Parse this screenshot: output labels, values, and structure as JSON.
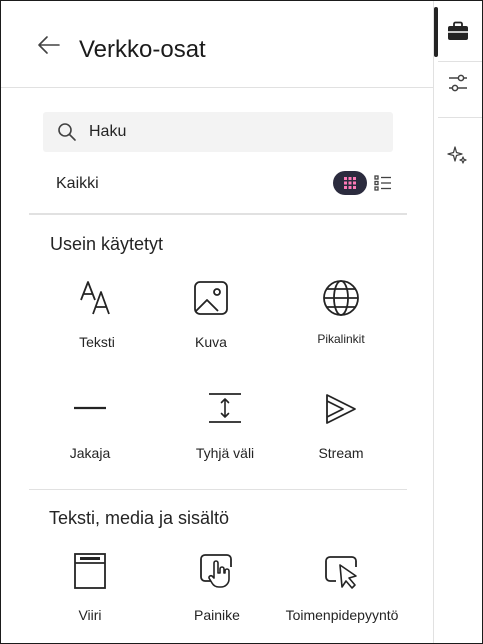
{
  "header": {
    "title": "Verkko-osat"
  },
  "search": {
    "placeholder": "Haku",
    "value": ""
  },
  "filter": {
    "label": "Kaikki"
  },
  "sections": [
    {
      "title": "Usein käytetyt",
      "items": [
        {
          "label": "Teksti",
          "icon": "text-icon"
        },
        {
          "label": "Kuva",
          "icon": "image-icon"
        },
        {
          "label": "Pikalinkit",
          "icon": "globe-icon"
        },
        {
          "label": "Jakaja",
          "icon": "divider-icon"
        },
        {
          "label": "Tyhjä väli",
          "icon": "spacer-icon"
        },
        {
          "label": "Stream",
          "icon": "stream-icon"
        }
      ]
    },
    {
      "title": "Teksti, media ja sisältö",
      "items": [
        {
          "label": "Viiri",
          "icon": "banner-icon"
        },
        {
          "label": "Painike",
          "icon": "button-icon"
        },
        {
          "label": "Toimenpidepyyntö",
          "icon": "call-to-action-icon"
        }
      ]
    }
  ],
  "rail": {
    "items": [
      "toolbox-icon",
      "sliders-icon",
      "sparkle-icon"
    ]
  },
  "colors": {
    "accent_dark": "#2b2b3e",
    "text": "#242424",
    "divider": "#e1e1e1",
    "search_bg": "#f3f3f3"
  }
}
